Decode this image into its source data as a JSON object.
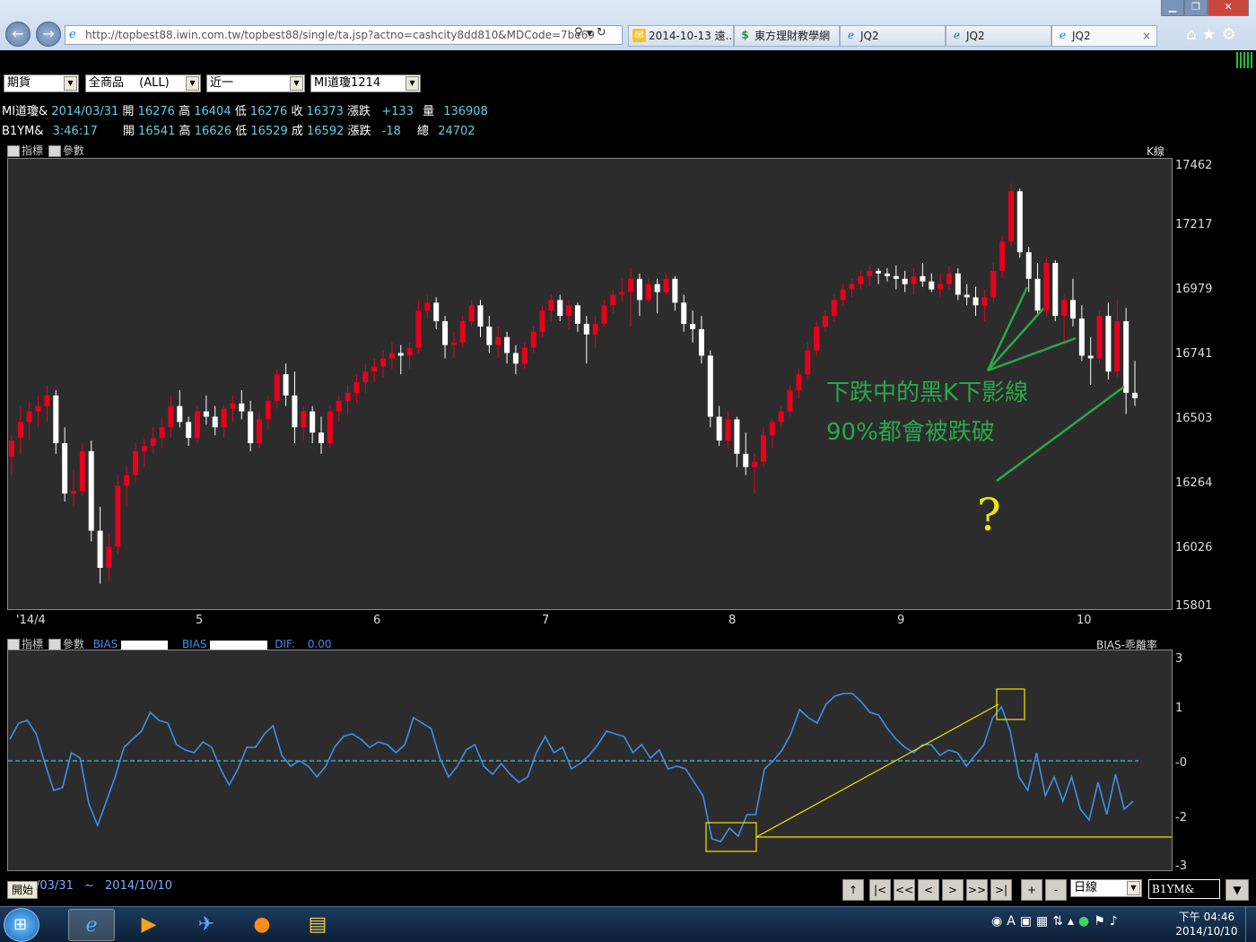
{
  "browser": {
    "url": "http://topbest88.iwin.com.tw/topbest88/single/ta.jsp?actno=cashcity8dd810&MDCode=7be69",
    "tabs": [
      {
        "label": "2014-10-13 遠...",
        "icon": "mail-icon"
      },
      {
        "label": "東方理財教學網",
        "icon": "dollar-icon"
      },
      {
        "label": "JQ2",
        "icon": "ie-icon"
      },
      {
        "label": "JQ2",
        "icon": "ie-icon"
      },
      {
        "label": "JQ2",
        "icon": "ie-icon",
        "active": true
      }
    ],
    "tab_close": "×"
  },
  "app": {
    "selects": [
      {
        "value": "期貨"
      },
      {
        "value": "全商品 　(ALL)"
      },
      {
        "value": "近一"
      },
      {
        "value": "MI道瓊1214"
      }
    ],
    "quote1": {
      "symbol": "MI道瓊&",
      "date": "2014/03/31",
      "open_label": "開",
      "open": "16276",
      "high_label": "高",
      "high": "16404",
      "low_label": "低",
      "low": "16276",
      "close_label": "收",
      "close": "16373",
      "change_label": "漲跌",
      "change": "+133",
      "volume_label": "量",
      "volume": "136908"
    },
    "quote2": {
      "symbol": "B1YM&",
      "time": "3:46:17",
      "open_label": "開",
      "open": "16541",
      "high_label": "高",
      "high": "16626",
      "low_label": "低",
      "low": "16529",
      "close_label": "成",
      "close": "16592",
      "change_label": "漲跌",
      "change": "-18",
      "total_label": "總",
      "total": "24702"
    },
    "main_panel": {
      "tool_indicator": "指標",
      "tool_param": "參數",
      "title": "K線",
      "y_labels": [
        "17462",
        "17217",
        "16979",
        "16741",
        "16503",
        "16264",
        "16026",
        "15801"
      ],
      "x_labels": [
        "'14/4",
        "5",
        "6",
        "7",
        "8",
        "9",
        "10"
      ],
      "annotation_line1": "下跌中的黑K下影線",
      "annotation_line2": "90%都會被跌破",
      "question_mark": "?"
    },
    "bias_panel": {
      "tool_indicator": "指標",
      "tool_param": "參數",
      "bias_label_1": "BIAS",
      "bias_label_2": "BIAS",
      "dif_label": "DIF:",
      "dif_value": "0.00",
      "title": "BIAS-乖離率",
      "y_labels": [
        "3",
        "1",
        "-0",
        "-2",
        "-3"
      ]
    },
    "bottom": {
      "start_label": "開始",
      "date_from": "/03/31",
      "tilde": "~",
      "date_to": "2014/10/10",
      "buttons": [
        "↑",
        "|<",
        "<<",
        "<",
        ">",
        ">>",
        ">|",
        "+",
        "-"
      ],
      "period": "日線",
      "symbol": "B1YM&",
      "dropdown_arrow": "▼"
    }
  },
  "taskbar": {
    "clock_line1": "下午 04:46",
    "clock_line2": "2014/10/10"
  },
  "colors": {
    "up_candle": "#e8001c",
    "down_candle": "#ffffff",
    "panel_bg": "#2c2c2c",
    "annotation_green": "#2aa84a",
    "annotation_yellow": "#f2e600",
    "bias_line": "#3f8fe8",
    "quote_value": "#5fd0e6"
  },
  "chart_data": [
    {
      "type": "candlestick",
      "title": "K線",
      "x_ticks": [
        "'14/4",
        "5",
        "6",
        "7",
        "8",
        "9",
        "10"
      ],
      "ylim": [
        15801,
        17462
      ],
      "y_ticks": [
        17462,
        17217,
        16979,
        16741,
        16503,
        16264,
        16026,
        15801
      ],
      "candles": [
        [
          16370,
          16450,
          16300,
          16430
        ],
        [
          16440,
          16560,
          16380,
          16500
        ],
        [
          16500,
          16580,
          16430,
          16540
        ],
        [
          16540,
          16600,
          16480,
          16560
        ],
        [
          16560,
          16640,
          16500,
          16600
        ],
        [
          16600,
          16620,
          16380,
          16420
        ],
        [
          16420,
          16480,
          16200,
          16230
        ],
        [
          16230,
          16320,
          16180,
          16240
        ],
        [
          16240,
          16420,
          16220,
          16390
        ],
        [
          16390,
          16430,
          16050,
          16090
        ],
        [
          16090,
          16180,
          15890,
          15950
        ],
        [
          15950,
          16080,
          15900,
          16030
        ],
        [
          16030,
          16300,
          16000,
          16260
        ],
        [
          16260,
          16330,
          16180,
          16300
        ],
        [
          16300,
          16420,
          16270,
          16390
        ],
        [
          16390,
          16440,
          16330,
          16410
        ],
        [
          16410,
          16480,
          16380,
          16440
        ],
        [
          16440,
          16520,
          16400,
          16480
        ],
        [
          16480,
          16600,
          16440,
          16560
        ],
        [
          16560,
          16620,
          16480,
          16500
        ],
        [
          16500,
          16520,
          16410,
          16440
        ],
        [
          16440,
          16560,
          16420,
          16540
        ],
        [
          16540,
          16600,
          16490,
          16520
        ],
        [
          16520,
          16560,
          16450,
          16480
        ],
        [
          16480,
          16560,
          16440,
          16550
        ],
        [
          16550,
          16600,
          16500,
          16570
        ],
        [
          16570,
          16620,
          16510,
          16540
        ],
        [
          16540,
          16580,
          16390,
          16420
        ],
        [
          16420,
          16540,
          16400,
          16510
        ],
        [
          16510,
          16600,
          16470,
          16580
        ],
        [
          16580,
          16700,
          16550,
          16680
        ],
        [
          16680,
          16720,
          16560,
          16600
        ],
        [
          16600,
          16690,
          16420,
          16480
        ],
        [
          16480,
          16560,
          16430,
          16540
        ],
        [
          16540,
          16560,
          16420,
          16460
        ],
        [
          16460,
          16520,
          16380,
          16420
        ],
        [
          16420,
          16560,
          16400,
          16540
        ],
        [
          16540,
          16600,
          16500,
          16580
        ],
        [
          16580,
          16640,
          16530,
          16610
        ],
        [
          16610,
          16680,
          16570,
          16650
        ],
        [
          16650,
          16720,
          16610,
          16690
        ],
        [
          16690,
          16740,
          16650,
          16710
        ],
        [
          16710,
          16770,
          16670,
          16740
        ],
        [
          16740,
          16800,
          16700,
          16760
        ],
        [
          16760,
          16790,
          16680,
          16750
        ],
        [
          16750,
          16800,
          16700,
          16780
        ],
        [
          16780,
          16960,
          16760,
          16920
        ],
        [
          16920,
          16980,
          16890,
          16950
        ],
        [
          16950,
          16970,
          16850,
          16880
        ],
        [
          16880,
          16900,
          16740,
          16790
        ],
        [
          16790,
          16840,
          16740,
          16800
        ],
        [
          16800,
          16900,
          16780,
          16880
        ],
        [
          16880,
          16960,
          16860,
          16940
        ],
        [
          16940,
          16960,
          16820,
          16860
        ],
        [
          16860,
          16900,
          16760,
          16790
        ],
        [
          16790,
          16860,
          16740,
          16820
        ],
        [
          16820,
          16840,
          16720,
          16760
        ],
        [
          16760,
          16790,
          16680,
          16720
        ],
        [
          16720,
          16800,
          16700,
          16780
        ],
        [
          16780,
          16860,
          16760,
          16840
        ],
        [
          16840,
          16940,
          16820,
          16920
        ],
        [
          16920,
          16980,
          16880,
          16960
        ],
        [
          16960,
          16980,
          16880,
          16900
        ],
        [
          16900,
          16960,
          16850,
          16940
        ],
        [
          16940,
          16950,
          16840,
          16870
        ],
        [
          16870,
          16900,
          16720,
          16830
        ],
        [
          16830,
          16900,
          16780,
          16870
        ],
        [
          16870,
          16960,
          16860,
          16940
        ],
        [
          16940,
          17000,
          16910,
          16980
        ],
        [
          16980,
          17040,
          16950,
          16990
        ],
        [
          16990,
          17080,
          16860,
          17040
        ],
        [
          17040,
          17060,
          16900,
          16960
        ],
        [
          16960,
          17040,
          16950,
          17020
        ],
        [
          17020,
          17040,
          16910,
          16990
        ],
        [
          16990,
          17060,
          16980,
          17040
        ],
        [
          17040,
          17050,
          16920,
          16950
        ],
        [
          16950,
          16980,
          16840,
          16870
        ],
        [
          16870,
          16920,
          16800,
          16850
        ],
        [
          16850,
          16900,
          16720,
          16750
        ],
        [
          16750,
          16770,
          16480,
          16520
        ],
        [
          16520,
          16560,
          16410,
          16430
        ],
        [
          16430,
          16540,
          16400,
          16510
        ],
        [
          16510,
          16520,
          16330,
          16380
        ],
        [
          16380,
          16460,
          16300,
          16330
        ],
        [
          16330,
          16380,
          16230,
          16350
        ],
        [
          16350,
          16480,
          16330,
          16450
        ],
        [
          16450,
          16510,
          16400,
          16500
        ],
        [
          16500,
          16560,
          16480,
          16540
        ],
        [
          16540,
          16640,
          16520,
          16620
        ],
        [
          16620,
          16700,
          16590,
          16680
        ],
        [
          16680,
          16800,
          16660,
          16770
        ],
        [
          16770,
          16880,
          16750,
          16860
        ],
        [
          16860,
          16920,
          16840,
          16900
        ],
        [
          16900,
          16980,
          16880,
          16960
        ],
        [
          16960,
          17020,
          16940,
          17000
        ],
        [
          17000,
          17040,
          16970,
          17020
        ],
        [
          17020,
          17070,
          17000,
          17050
        ],
        [
          17050,
          17090,
          17010,
          17070
        ],
        [
          17070,
          17080,
          17020,
          17060
        ],
        [
          17060,
          17080,
          17030,
          17050
        ],
        [
          17050,
          17090,
          17000,
          17040
        ],
        [
          17040,
          17070,
          16990,
          17020
        ],
        [
          17020,
          17080,
          16980,
          17050
        ],
        [
          17050,
          17100,
          17010,
          17030
        ],
        [
          17030,
          17060,
          16990,
          17000
        ],
        [
          17000,
          17060,
          16970,
          17020
        ],
        [
          17020,
          17090,
          17000,
          17060
        ],
        [
          17060,
          17080,
          16960,
          16980
        ],
        [
          16980,
          17020,
          16940,
          16970
        ],
        [
          16970,
          17010,
          16900,
          16940
        ],
        [
          16940,
          17000,
          16880,
          16970
        ],
        [
          16970,
          17100,
          16950,
          17070
        ],
        [
          17070,
          17200,
          17040,
          17180
        ],
        [
          17180,
          17400,
          17160,
          17370
        ],
        [
          17370,
          17380,
          17120,
          17140
        ],
        [
          17140,
          17160,
          16990,
          17040
        ],
        [
          17040,
          17100,
          16900,
          16920
        ],
        [
          16920,
          17120,
          16900,
          17100
        ],
        [
          17100,
          17110,
          16880,
          16900
        ],
        [
          16900,
          16980,
          16790,
          16960
        ],
        [
          16960,
          17040,
          16860,
          16890
        ],
        [
          16890,
          16940,
          16730,
          16750
        ],
        [
          16750,
          16820,
          16640,
          16740
        ],
        [
          16740,
          16920,
          16720,
          16900
        ],
        [
          16900,
          16950,
          16660,
          16690
        ],
        [
          16690,
          16960,
          16670,
          16880
        ],
        [
          16880,
          16930,
          16530,
          16610
        ],
        [
          16610,
          16730,
          16560,
          16590
        ]
      ]
    },
    {
      "type": "line",
      "title": "BIAS-乖離率",
      "ylim": [
        -3,
        3
      ],
      "y_ticks": [
        3,
        1,
        0,
        -2,
        -3
      ],
      "reference_line": 0,
      "series": [
        {
          "name": "BIAS",
          "values": [
            0.8,
            1.4,
            1.5,
            1.0,
            -0.1,
            -1.1,
            -1.0,
            0.3,
            0.1,
            -1.6,
            -2.4,
            -1.5,
            -0.6,
            0.5,
            0.8,
            1.1,
            1.8,
            1.5,
            1.4,
            0.6,
            0.4,
            0.3,
            0.7,
            0.5,
            -0.3,
            -0.9,
            -0.3,
            0.5,
            0.5,
            1.0,
            1.3,
            0.2,
            -0.2,
            0.0,
            -0.2,
            -0.6,
            -0.2,
            0.5,
            0.9,
            1.0,
            0.8,
            0.5,
            0.7,
            0.6,
            0.3,
            0.6,
            1.6,
            1.4,
            1.2,
            0.1,
            -0.6,
            -0.2,
            0.4,
            0.6,
            -0.2,
            -0.5,
            -0.1,
            -0.5,
            -0.8,
            -0.6,
            0.3,
            0.9,
            0.3,
            0.5,
            -0.3,
            -0.1,
            0.2,
            0.6,
            1.1,
            1.0,
            0.9,
            0.3,
            0.6,
            0.1,
            0.4,
            -0.3,
            -0.2,
            -0.3,
            -0.8,
            -1.3,
            -2.9,
            -3.0,
            -2.5,
            -2.8,
            -2.0,
            -2.0,
            -0.3,
            0.0,
            0.4,
            1.0,
            1.9,
            1.6,
            1.4,
            2.1,
            2.4,
            2.5,
            2.5,
            2.2,
            1.8,
            1.7,
            1.2,
            0.8,
            0.5,
            0.3,
            0.6,
            0.6,
            0.2,
            0.4,
            0.3,
            -0.2,
            0.2,
            0.6,
            1.6,
            2.0,
            1.1,
            -0.6,
            -1.1,
            0.3,
            -1.3,
            -0.6,
            -1.5,
            -0.6,
            -1.8,
            -2.2,
            -0.8,
            -2.0,
            -0.5,
            -1.8,
            -1.5
          ]
        }
      ]
    }
  ]
}
